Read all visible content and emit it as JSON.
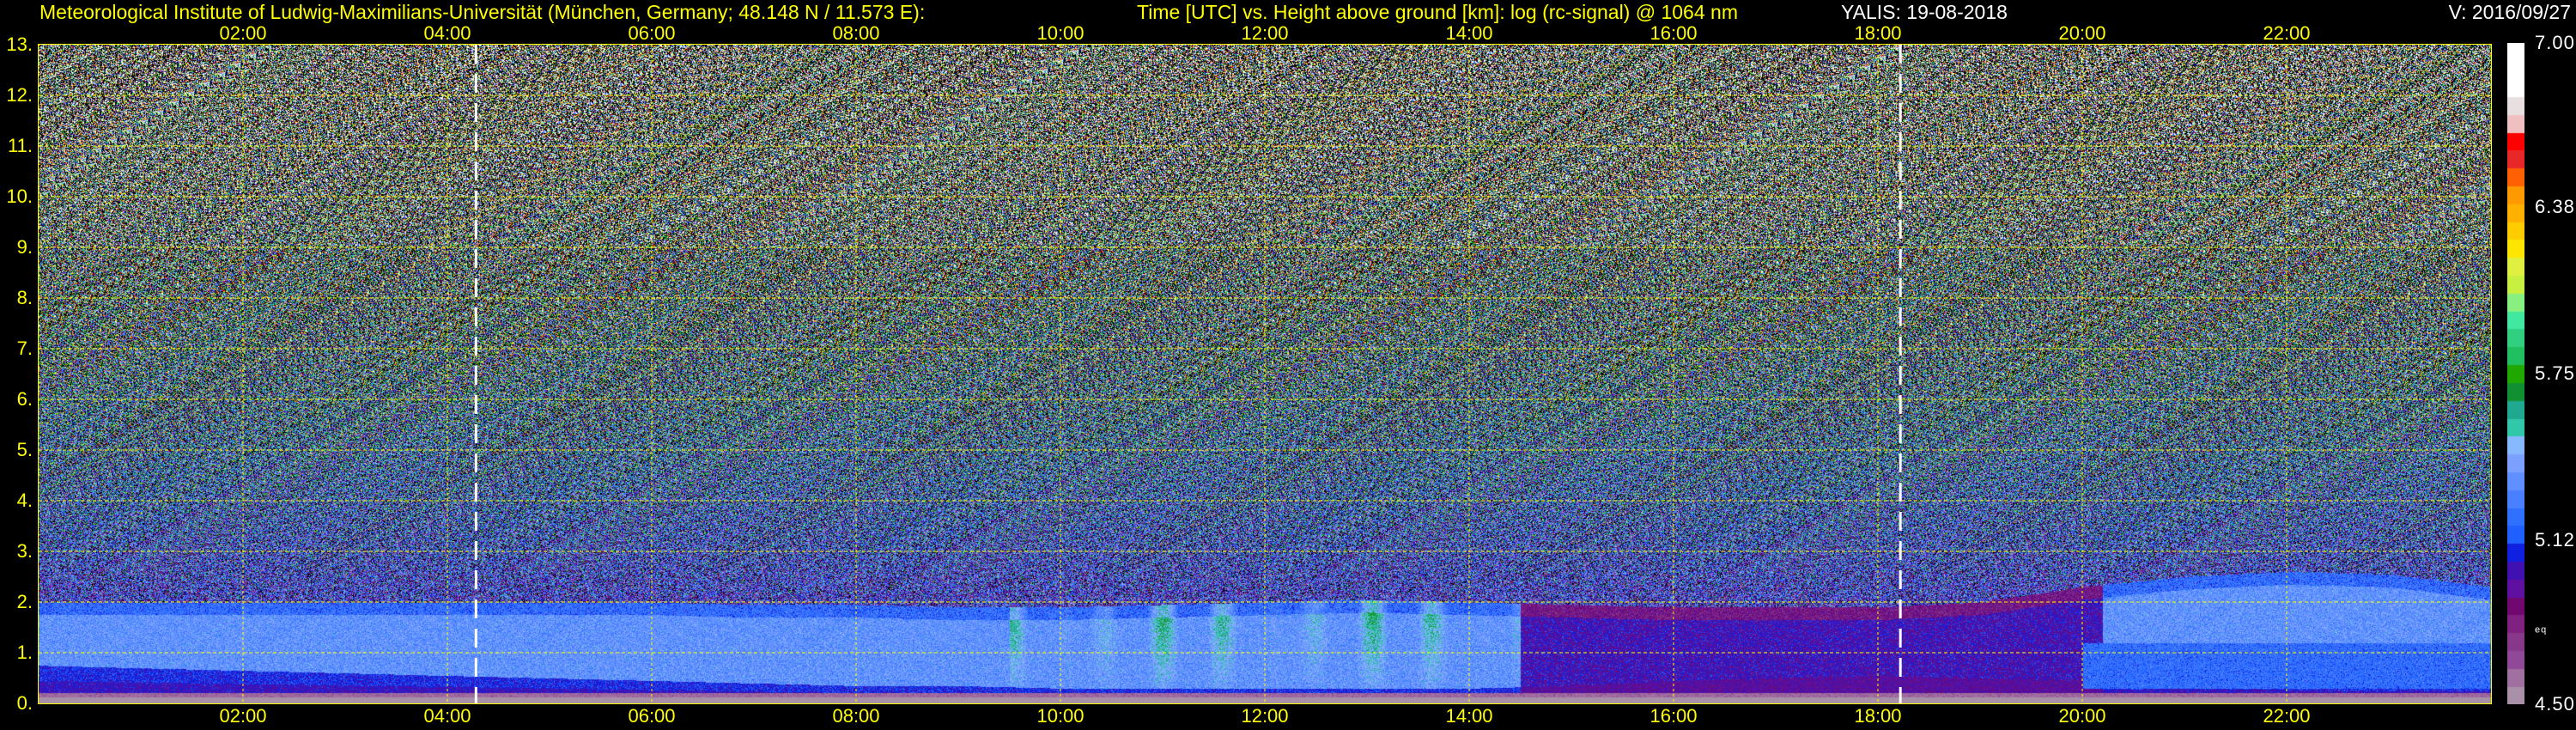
{
  "header": {
    "institute": "Meteorological Institute of Ludwig-Maximilians-Universität (München, Germany; 48.148 N / 11.573 E):",
    "plot_title": "Time [UTC] vs. Height above ground [km]: log (rc-signal) @ 1064 nm",
    "instrument_date": "YALIS: 19-08-2018",
    "version": "V: 2016/09/27"
  },
  "chart_data": {
    "type": "heatmap",
    "title": "Time [UTC] vs. Height above ground [km]: log (rc-signal) @ 1064 nm",
    "xlabel": "Time [UTC]",
    "ylabel": "Height above ground [km]",
    "xlim_hours": [
      0,
      24
    ],
    "ylim_km": [
      0,
      13
    ],
    "x_ticks": [
      "02:00",
      "04:00",
      "06:00",
      "08:00",
      "10:00",
      "12:00",
      "14:00",
      "16:00",
      "18:00",
      "20:00",
      "22:00"
    ],
    "x_tick_hours": [
      2,
      4,
      6,
      8,
      10,
      12,
      14,
      16,
      18,
      20,
      22
    ],
    "y_ticks": [
      "0.",
      "1.",
      "2.",
      "3.",
      "4.",
      "5.",
      "6.",
      "7.",
      "8.",
      "9.",
      "10.",
      "11.",
      "12.",
      "13."
    ],
    "y_tick_km": [
      0,
      1,
      2,
      3,
      4,
      5,
      6,
      7,
      8,
      9,
      10,
      11,
      12,
      13
    ],
    "grid": true,
    "grid_color": "#ffff00",
    "marker_lines_hours": [
      4.28,
      18.22
    ],
    "marker_line_color": "#ffffff",
    "colorbar": {
      "range": [
        4.5,
        7.0
      ],
      "tick_labels": [
        "7.00",
        "6.38",
        "5.75",
        "5.12",
        "4.50"
      ],
      "tick_values": [
        7.0,
        6.38,
        5.75,
        5.12,
        4.5
      ],
      "note": "eq",
      "note_value": 4.78,
      "colors_low_to_high": [
        "#a890a8",
        "#a070a0",
        "#904898",
        "#883888",
        "#802080",
        "#700870",
        "#6010a0",
        "#4010b0",
        "#1020e0",
        "#2060ff",
        "#3070ff",
        "#4a80ff",
        "#6090ff",
        "#7ca0ff",
        "#88b8ff",
        "#30c8a8",
        "#20a890",
        "#109030",
        "#20a800",
        "#20c060",
        "#30d080",
        "#40e8a0",
        "#88f080",
        "#c8f040",
        "#e0f040",
        "#ffe600",
        "#ffcc00",
        "#ffb000",
        "#ff9900",
        "#ff6000",
        "#e82828",
        "#ff0000",
        "#f0c0c0",
        "#e8e0e0",
        "#ffffff",
        "#ffffff",
        "#ffffff"
      ]
    },
    "series": [
      {
        "name": "aerosol_layer_top_km",
        "hours": [
          0,
          1,
          2,
          3,
          4,
          5,
          6,
          7,
          8,
          9,
          10,
          11,
          12,
          13,
          14,
          15,
          16,
          17,
          18,
          19,
          20,
          21,
          22,
          23,
          24
        ],
        "values": [
          2.0,
          2.0,
          2.0,
          2.0,
          2.0,
          2.0,
          2.0,
          1.95,
          1.95,
          1.9,
          1.9,
          1.95,
          2.0,
          2.05,
          2.0,
          1.95,
          1.9,
          1.9,
          1.9,
          2.0,
          2.3,
          2.5,
          2.6,
          2.55,
          2.3
        ]
      },
      {
        "name": "surface_layer_top_km",
        "hours": [
          0,
          1,
          2,
          3,
          4,
          5,
          6,
          7,
          8,
          9,
          10,
          11,
          12,
          13,
          14,
          15,
          16,
          17,
          18,
          19,
          20,
          21,
          22,
          23,
          24
        ],
        "values": [
          0.75,
          0.7,
          0.65,
          0.6,
          0.55,
          0.5,
          0.45,
          0.4,
          0.35,
          0.35,
          0.3,
          0.3,
          0.3,
          0.3,
          0.3,
          0.35,
          0.45,
          0.5,
          0.55,
          0.5,
          0.45,
          0.5,
          0.45,
          0.4,
          0.4
        ]
      }
    ]
  }
}
